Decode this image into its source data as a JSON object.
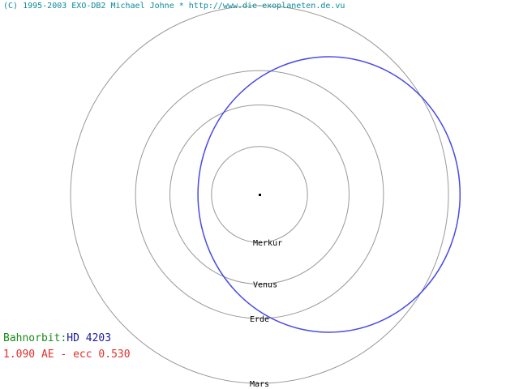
{
  "header": {
    "copyright": "(C) 1995-2003 EXO-DB2 Michael Johne * http://www.die-exoplaneten.de.vu"
  },
  "orbits": [
    {
      "name": "Merkur",
      "a_au": 0.387
    },
    {
      "name": "Venus",
      "a_au": 0.723
    },
    {
      "name": "Erde",
      "a_au": 1.0
    },
    {
      "name": "Mars",
      "a_au": 1.524
    }
  ],
  "planet": {
    "label_prefix": "Bahnorbit:",
    "name": "HD 4203",
    "semi_major_text": "1.090 AE",
    "separator": " - ",
    "ecc_text": "ecc 0.530",
    "a_au": 1.09,
    "ecc": 0.53
  },
  "colors": {
    "copyright": "#0a8a9a",
    "orbit_circles": "#999999",
    "planet_orbit": "#4a4ae6",
    "label_prefix": "#1a8a1a",
    "planet_name": "#1a1aa0",
    "params": "#e03030",
    "star": "#000000"
  }
}
